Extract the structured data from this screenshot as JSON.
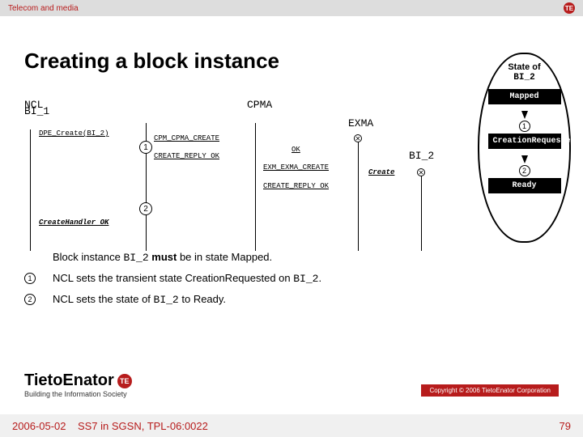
{
  "top": {
    "category": "Telecom and media",
    "badge": "TE"
  },
  "title": "Creating a block instance",
  "lifelines": {
    "bi1": "BI_1",
    "ncl": "NCL",
    "cpma": "CPMA",
    "exma": "EXMA",
    "bi2": "BI_2"
  },
  "msgs": {
    "m1": "DPE_Create(BI_2)",
    "m2": "CPM_CPMA_CREATE",
    "m3": "CREATE_REPLY OK",
    "m4": "OK",
    "m5": "EXM_EXMA_CREATE",
    "m6": "CREATE_REPLY OK",
    "m7": "Create",
    "m8": "CreateHandler OK"
  },
  "markers": {
    "one": "1",
    "two": "2"
  },
  "state": {
    "title1": "State of",
    "title2": "BI_2",
    "s1": "Mapped",
    "s2": "CreationRequested",
    "s3": "Ready"
  },
  "notes": {
    "n0a": "Block instance ",
    "n0_mono": "BI_2",
    "n0b": " ",
    "n0_must": "must",
    "n0c": " be in state Mapped.",
    "n1a": "NCL sets the transient state CreationRequested on ",
    "n1_mono": "BI_2",
    "n1b": ".",
    "n2a": "NCL sets the state of ",
    "n2_mono": "BI_2",
    "n2b": " to Ready."
  },
  "brand": {
    "name": "TietoEnator",
    "badge": "TE",
    "tag": "Building the Information Society"
  },
  "copyright": "Copyright © 2006 TietoEnator Corporation",
  "footer": {
    "date": "2006-05-02",
    "doc": "SS7 in SGSN, TPL-06:0022",
    "page": "79"
  }
}
